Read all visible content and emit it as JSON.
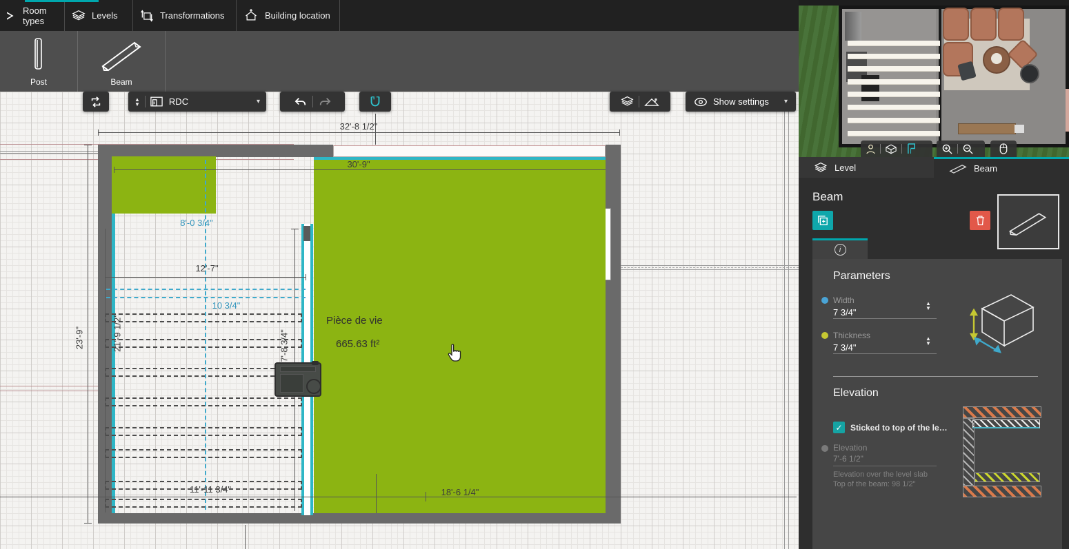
{
  "top_nav": {
    "tabs": [
      {
        "label": "Room types"
      },
      {
        "label": "Levels"
      },
      {
        "label": "Transformations"
      },
      {
        "label": "Building location"
      }
    ]
  },
  "tools": {
    "post": "Post",
    "beam": "Beam"
  },
  "canvas_toolbar": {
    "level_selector_value": "RDC",
    "show_settings_label": "Show settings"
  },
  "plan": {
    "room_label": "Pièce de vie",
    "room_area": "665.63 ft²",
    "dimensions": {
      "overall_width": "32'-8 1/2\"",
      "green_room_width": "30'-9\"",
      "overall_depth": "23'-9\"",
      "left_room_depth": "21'-9 1/2\"",
      "beam_offset": "8'-0 3/4\"",
      "left_room_width": "12'-7\"",
      "beam_spacing": "10 3/4\"",
      "beam_length": "17'-8 3/4\"",
      "bottom_left_width": "11'-11 3/4\"",
      "bottom_right_width": "18'-6 1/4\""
    }
  },
  "panel": {
    "tabs": [
      {
        "label": "Level"
      },
      {
        "label": "Beam"
      }
    ],
    "title": "Beam",
    "parameters": {
      "heading": "Parameters",
      "width_label": "Width",
      "width_value": "7 3/4\"",
      "thickness_label": "Thickness",
      "thickness_value": "7 3/4\""
    },
    "elevation": {
      "heading": "Elevation",
      "sticked_label": "Sticked to top of the le…",
      "elevation_label": "Elevation",
      "elevation_value": "7'-6 1/2\"",
      "helper_line1": "Elevation over the level slab",
      "helper_line2": "Top of the beam: 98 1/2\""
    }
  },
  "colors": {
    "accent_teal": "#00a7ad",
    "selection_cyan": "#2eb6c6",
    "room_green": "#8cb412",
    "delete_red": "#e25849",
    "width_dot_blue": "#4aa4d6",
    "thickness_dot_yellow": "#c6c832"
  }
}
